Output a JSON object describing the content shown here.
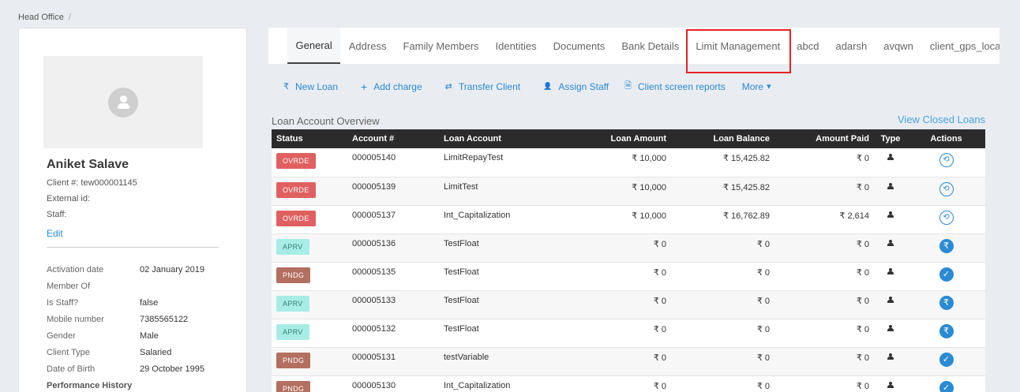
{
  "breadcrumb": {
    "office": "Head Office",
    "separator": "/"
  },
  "profile": {
    "name": "Aniket Salave",
    "client_no": "Client #: tew000001145",
    "external_id": "External id:",
    "staff": "Staff:",
    "edit": "Edit",
    "details": [
      {
        "label": "Activation date",
        "value": "02 January 2019"
      },
      {
        "label": "Member Of",
        "value": ""
      },
      {
        "label": "Is Staff?",
        "value": "false"
      },
      {
        "label": "Mobile number",
        "value": "7385565122"
      },
      {
        "label": "Gender",
        "value": "Male"
      },
      {
        "label": "Client Type",
        "value": "Salaried"
      },
      {
        "label": "Date of Birth",
        "value": "29 October 1995"
      }
    ],
    "performance_history": "Performance History"
  },
  "tabs": [
    "General",
    "Address",
    "Family Members",
    "Identities",
    "Documents",
    "Bank Details",
    "Limit Management",
    "abcd",
    "adarsh",
    "avqwn",
    "client_gps_location"
  ],
  "actions": [
    {
      "icon": "rupee-icon",
      "glyph": "₹",
      "label": "New Loan"
    },
    {
      "icon": "plus-icon",
      "glyph": "+",
      "label": "Add charge"
    },
    {
      "icon": "transfer-icon",
      "glyph": "⇄",
      "label": "Transfer Client"
    },
    {
      "icon": "user-icon",
      "glyph": "👤",
      "label": "Assign Staff"
    },
    {
      "icon": "file-icon",
      "glyph": "🗎",
      "label": "Client screen reports"
    },
    {
      "icon": "caret-down-icon",
      "glyph": "▾",
      "label": "More"
    }
  ],
  "overview": {
    "title": "Loan Account Overview",
    "view_closed": "View Closed Loans",
    "columns": [
      "Status",
      "Account #",
      "Loan Account",
      "Loan Amount",
      "Loan Balance",
      "Amount Paid",
      "Type",
      "Actions"
    ],
    "rows": [
      {
        "status": "OVRDE",
        "account": "000005140",
        "product": "LimitRepayTest",
        "amount": "₹ 10,000",
        "balance": "₹ 15,425.82",
        "paid": "₹ 0",
        "action": "repay"
      },
      {
        "status": "OVRDE",
        "account": "000005139",
        "product": "LimitTest",
        "amount": "₹ 10,000",
        "balance": "₹ 15,425.82",
        "paid": "₹ 0",
        "action": "repay"
      },
      {
        "status": "OVRDE",
        "account": "000005137",
        "product": "Int_Capitalization",
        "amount": "₹ 10,000",
        "balance": "₹ 16,762.89",
        "paid": "₹ 2,614",
        "action": "repay"
      },
      {
        "status": "APRV",
        "account": "000005136",
        "product": "TestFloat",
        "amount": "₹ 0",
        "balance": "₹ 0",
        "paid": "₹ 0",
        "action": "disburse"
      },
      {
        "status": "PNDG",
        "account": "000005135",
        "product": "TestFloat",
        "amount": "₹ 0",
        "balance": "₹ 0",
        "paid": "₹ 0",
        "action": "approve"
      },
      {
        "status": "APRV",
        "account": "000005133",
        "product": "TestFloat",
        "amount": "₹ 0",
        "balance": "₹ 0",
        "paid": "₹ 0",
        "action": "disburse"
      },
      {
        "status": "APRV",
        "account": "000005132",
        "product": "TestFloat",
        "amount": "₹ 0",
        "balance": "₹ 0",
        "paid": "₹ 0",
        "action": "disburse"
      },
      {
        "status": "PNDG",
        "account": "000005131",
        "product": "testVariable",
        "amount": "₹ 0",
        "balance": "₹ 0",
        "paid": "₹ 0",
        "action": "approve"
      },
      {
        "status": "PNDG",
        "account": "000005130",
        "product": "Int_Capitalization",
        "amount": "₹ 0",
        "balance": "₹ 0",
        "paid": "₹ 0",
        "action": "approve"
      }
    ]
  },
  "colors": {
    "link": "#2a8ad4",
    "overdue": "#e06060",
    "approved": "#a8ece6",
    "pending": "#b36f5f",
    "highlight": "#e52222"
  }
}
